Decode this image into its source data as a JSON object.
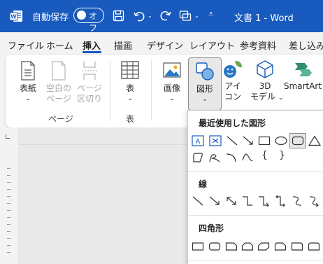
{
  "titlebar": {
    "autosave_label": "自動保存",
    "toggle_state": "オフ",
    "document_title": "文書 1 - Word",
    "more_label": "⩡",
    "caret": "⌄",
    "bg_color": "#185abd"
  },
  "tabs": [
    "ファイル",
    "ホーム",
    "挿入",
    "描画",
    "デザイン",
    "レイアウト",
    "参考資料",
    "差し込み"
  ],
  "active_tab": "挿入",
  "ribbon": {
    "cover": {
      "line1": "表紙",
      "caret": "⌄"
    },
    "blank_page": {
      "line1": "空白の",
      "line2": "ページ"
    },
    "page_break": {
      "line1": "ページ",
      "line2": "区切り"
    },
    "group_pages": "ページ",
    "table": {
      "line1": "表",
      "caret": "⌄"
    },
    "group_table": "表",
    "pictures": {
      "line1": "画像",
      "caret": "⌄"
    },
    "shapes": {
      "line1": "図形",
      "caret": "⌄"
    },
    "icons": {
      "line1": "アイ",
      "line2": "コン"
    },
    "models3d": {
      "line1": "3D",
      "line2": "モデル",
      "caret": "⌄"
    },
    "smartart": {
      "line1": "SmartArt"
    }
  },
  "shapes_menu": {
    "recent_header": "最近使用した図形",
    "lines_header": "線",
    "rectangles_header": "四角形",
    "brace_left": "{",
    "brace_right": "}"
  },
  "icons": {
    "word": "word-logo",
    "save": "save-icon",
    "undo": "undo-icon",
    "redo": "redo-icon",
    "more": "customize-qat-icon"
  }
}
